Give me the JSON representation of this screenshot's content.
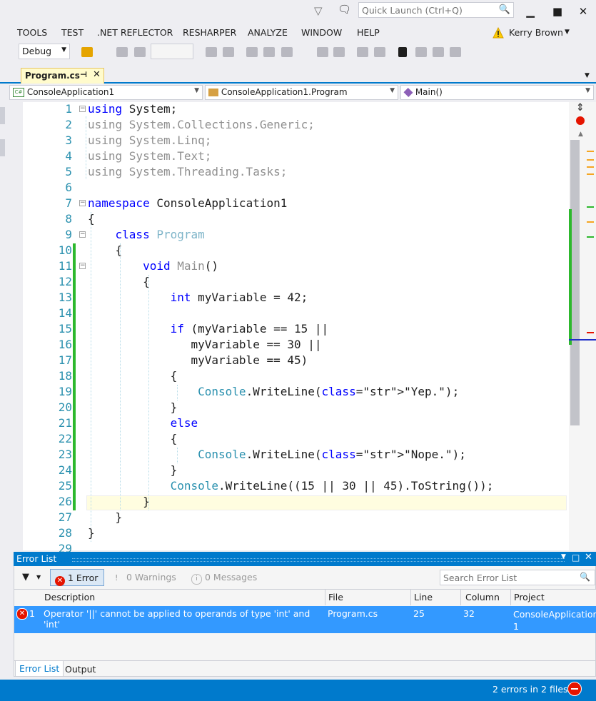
{
  "quick_launch": {
    "placeholder": "Quick Launch (Ctrl+Q)"
  },
  "menu": [
    "TOOLS",
    "TEST",
    ".NET REFLECTOR",
    "RESHARPER",
    "ANALYZE",
    "WINDOW",
    "HELP"
  ],
  "user": {
    "name": "Kerry Brown"
  },
  "toolbar": {
    "config": "Debug"
  },
  "doc_tab": {
    "label": "Program.cs"
  },
  "navbar": {
    "project": "ConsoleApplication1",
    "class": "ConsoleApplication1.Program",
    "member": "Main()"
  },
  "code_lines": [
    {
      "n": "1",
      "text": "using System;"
    },
    {
      "n": "2",
      "text": "using System.Collections.Generic;"
    },
    {
      "n": "3",
      "text": "using System.Linq;"
    },
    {
      "n": "4",
      "text": "using System.Text;"
    },
    {
      "n": "5",
      "text": "using System.Threading.Tasks;"
    },
    {
      "n": "6",
      "text": ""
    },
    {
      "n": "7",
      "text": "namespace ConsoleApplication1"
    },
    {
      "n": "8",
      "text": "{"
    },
    {
      "n": "9",
      "text": "    class Program"
    },
    {
      "n": "10",
      "text": "    {"
    },
    {
      "n": "11",
      "text": "        void Main()"
    },
    {
      "n": "12",
      "text": "        {"
    },
    {
      "n": "13",
      "text": "            int myVariable = 42;"
    },
    {
      "n": "14",
      "text": ""
    },
    {
      "n": "15",
      "text": "            if (myVariable == 15 ||"
    },
    {
      "n": "16",
      "text": "               myVariable == 30 ||"
    },
    {
      "n": "17",
      "text": "               myVariable == 45)"
    },
    {
      "n": "18",
      "text": "            {"
    },
    {
      "n": "19",
      "text": "                Console.WriteLine(\"Yep.\");"
    },
    {
      "n": "20",
      "text": "            }"
    },
    {
      "n": "21",
      "text": "            else"
    },
    {
      "n": "22",
      "text": "            {"
    },
    {
      "n": "23",
      "text": "                Console.WriteLine(\"Nope.\");"
    },
    {
      "n": "24",
      "text": "            }"
    },
    {
      "n": "25",
      "text": "            Console.WriteLine((15 || 30 || 45).ToString());"
    },
    {
      "n": "26",
      "text": "        }"
    },
    {
      "n": "27",
      "text": "    }"
    },
    {
      "n": "28",
      "text": "}"
    },
    {
      "n": "29",
      "text": ""
    }
  ],
  "error_list": {
    "title": "Error List",
    "filter_errors": "1 Error",
    "filter_warnings": "0 Warnings",
    "filter_messages": "0 Messages",
    "search_placeholder": "Search Error List",
    "columns": [
      "Description",
      "File",
      "Line",
      "Column",
      "Project"
    ],
    "rows": [
      {
        "num": "1",
        "description": "Operator '||' cannot be applied to operands of type 'int' and 'int'",
        "file": "Program.cs",
        "line": "25",
        "column": "32",
        "project": "ConsoleApplication 1"
      }
    ]
  },
  "bottom_tabs": [
    "Error List",
    "Output"
  ],
  "status": {
    "text": "2 errors in 2 files"
  },
  "colors": {
    "accent": "#007acc",
    "error": "#e51400",
    "selection": "#3399ff",
    "changed": "#2db82d"
  }
}
